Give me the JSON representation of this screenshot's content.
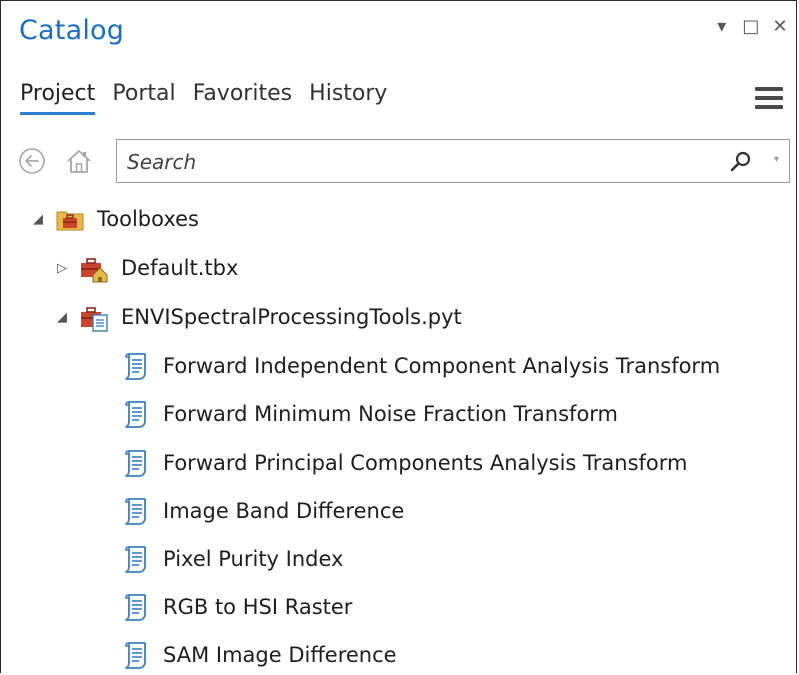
{
  "window": {
    "title": "Catalog",
    "controls": {
      "dropdown": "▾",
      "maximize": "□",
      "close": "✕"
    }
  },
  "tabs": [
    {
      "label": "Project",
      "active": true
    },
    {
      "label": "Portal",
      "active": false
    },
    {
      "label": "Favorites",
      "active": false
    },
    {
      "label": "History",
      "active": false
    }
  ],
  "nav": {
    "back_icon": "back-arrow-icon",
    "home_icon": "home-icon"
  },
  "search": {
    "placeholder": "Search",
    "value": ""
  },
  "tree": {
    "toolboxes": {
      "label": "Toolboxes",
      "expanded": true,
      "icon": "folder-toolbox-icon"
    },
    "default_tbx": {
      "label": "Default.tbx",
      "expanded": false,
      "icon": "default-toolbox-icon"
    },
    "pyt": {
      "label": "ENVISpectralProcessingTools.pyt",
      "expanded": true,
      "icon": "python-toolbox-icon"
    },
    "tools": [
      {
        "label": "Forward Independent Component Analysis Transform",
        "icon": "script-tool-icon"
      },
      {
        "label": "Forward Minimum Noise Fraction Transform",
        "icon": "script-tool-icon"
      },
      {
        "label": "Forward Principal Components Analysis Transform",
        "icon": "script-tool-icon"
      },
      {
        "label": "Image Band Difference",
        "icon": "script-tool-icon"
      },
      {
        "label": "Pixel Purity Index",
        "icon": "script-tool-icon"
      },
      {
        "label": "RGB to HSI Raster",
        "icon": "script-tool-icon"
      },
      {
        "label": "SAM Image Difference",
        "icon": "script-tool-icon"
      }
    ]
  },
  "colors": {
    "title": "#1a6fc4",
    "tab_underline": "#2c7fd1",
    "toolbox_red": "#c9452b",
    "folder_yellow": "#e8b84a",
    "script_blue": "#3a7fc0"
  }
}
